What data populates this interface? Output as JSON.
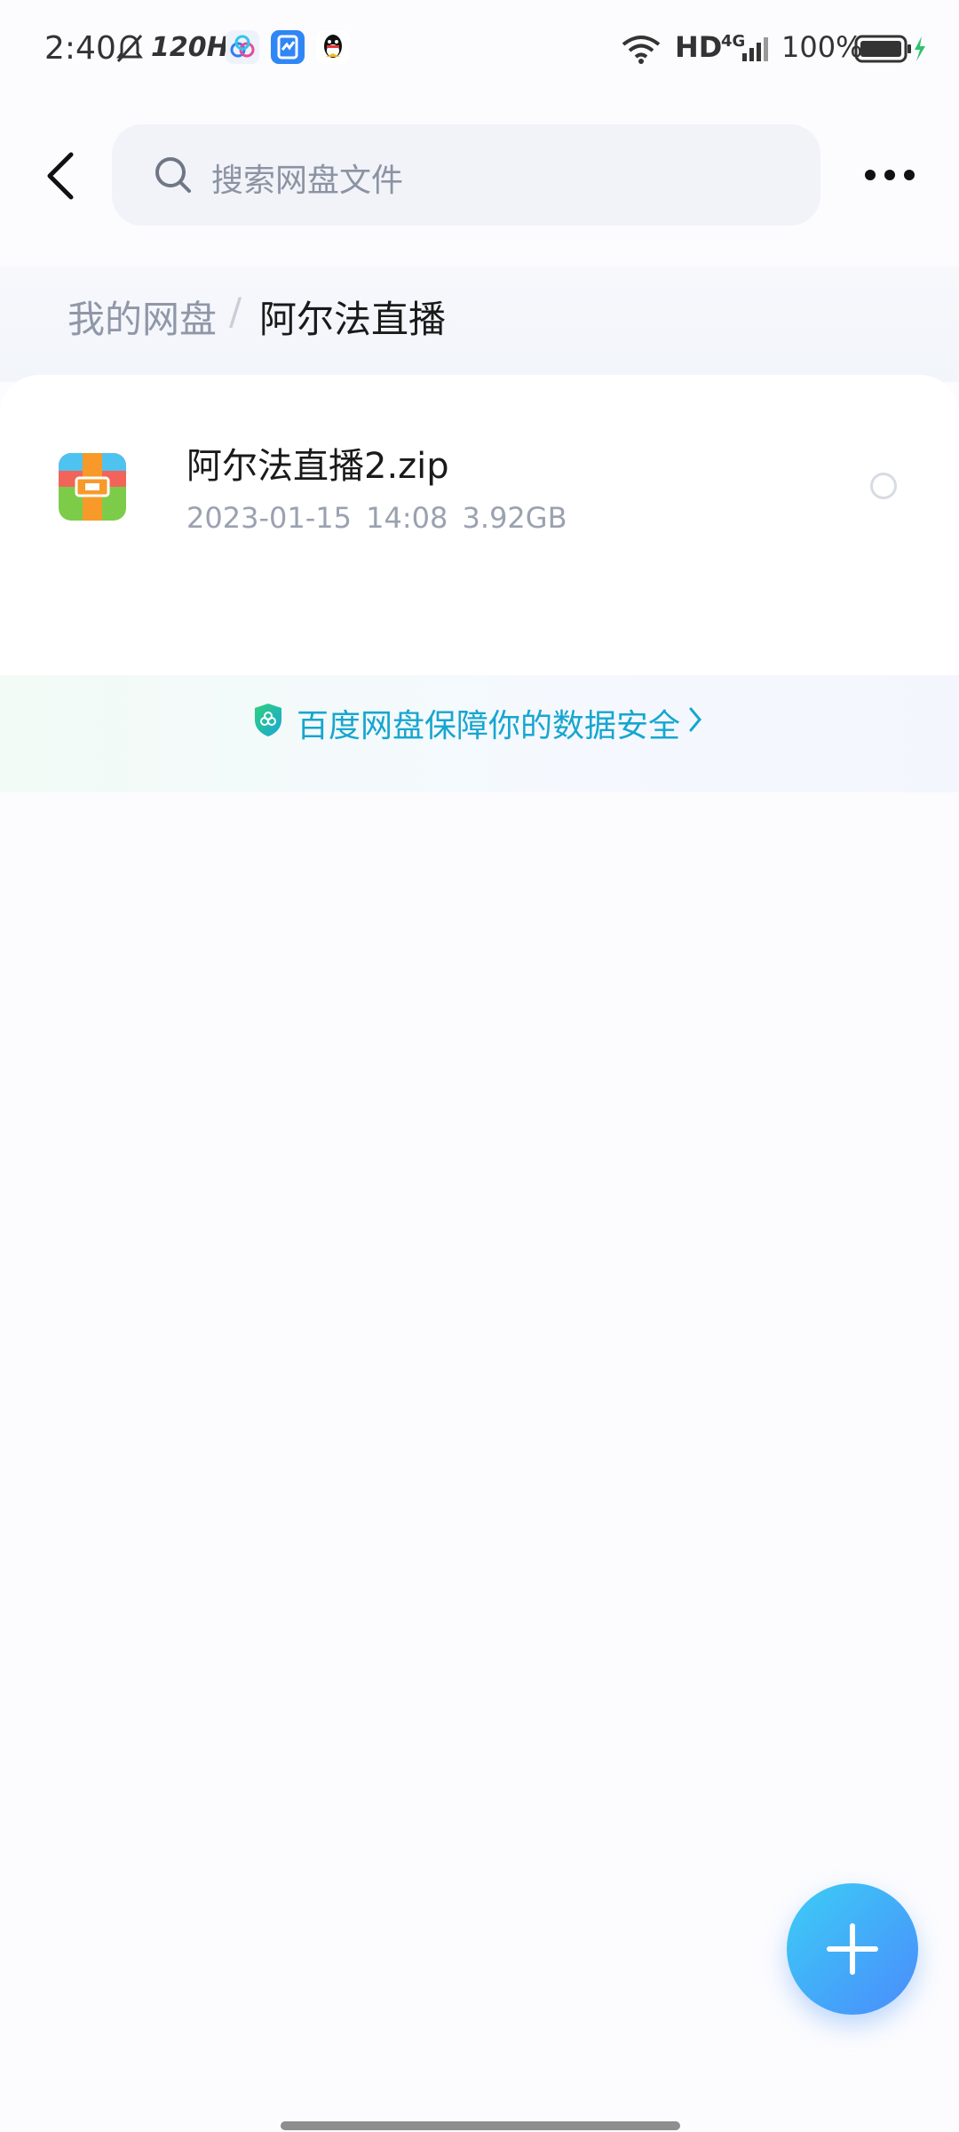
{
  "status_bar": {
    "time": "2:40",
    "refresh_rate": "120Hz",
    "network_label": "HD",
    "signal_label": "4G",
    "battery_percent": "100%"
  },
  "header": {
    "search_placeholder": "搜索网盘文件"
  },
  "breadcrumb": {
    "root": "我的网盘",
    "separator": "/",
    "current": "阿尔法直播"
  },
  "files": [
    {
      "name": "阿尔法直播2.zip",
      "date": "2023-01-15",
      "time": "14:08",
      "size": "3.92GB",
      "icon": "zip-archive-icon",
      "selected": false
    }
  ],
  "security_notice": {
    "text": "百度网盘保障你的数据安全",
    "color": "#17a6cf"
  },
  "fab": {
    "icon": "plus-icon"
  },
  "colors": {
    "accent_blue": "#4a8cfb",
    "accent_cyan": "#3ccdf6"
  }
}
